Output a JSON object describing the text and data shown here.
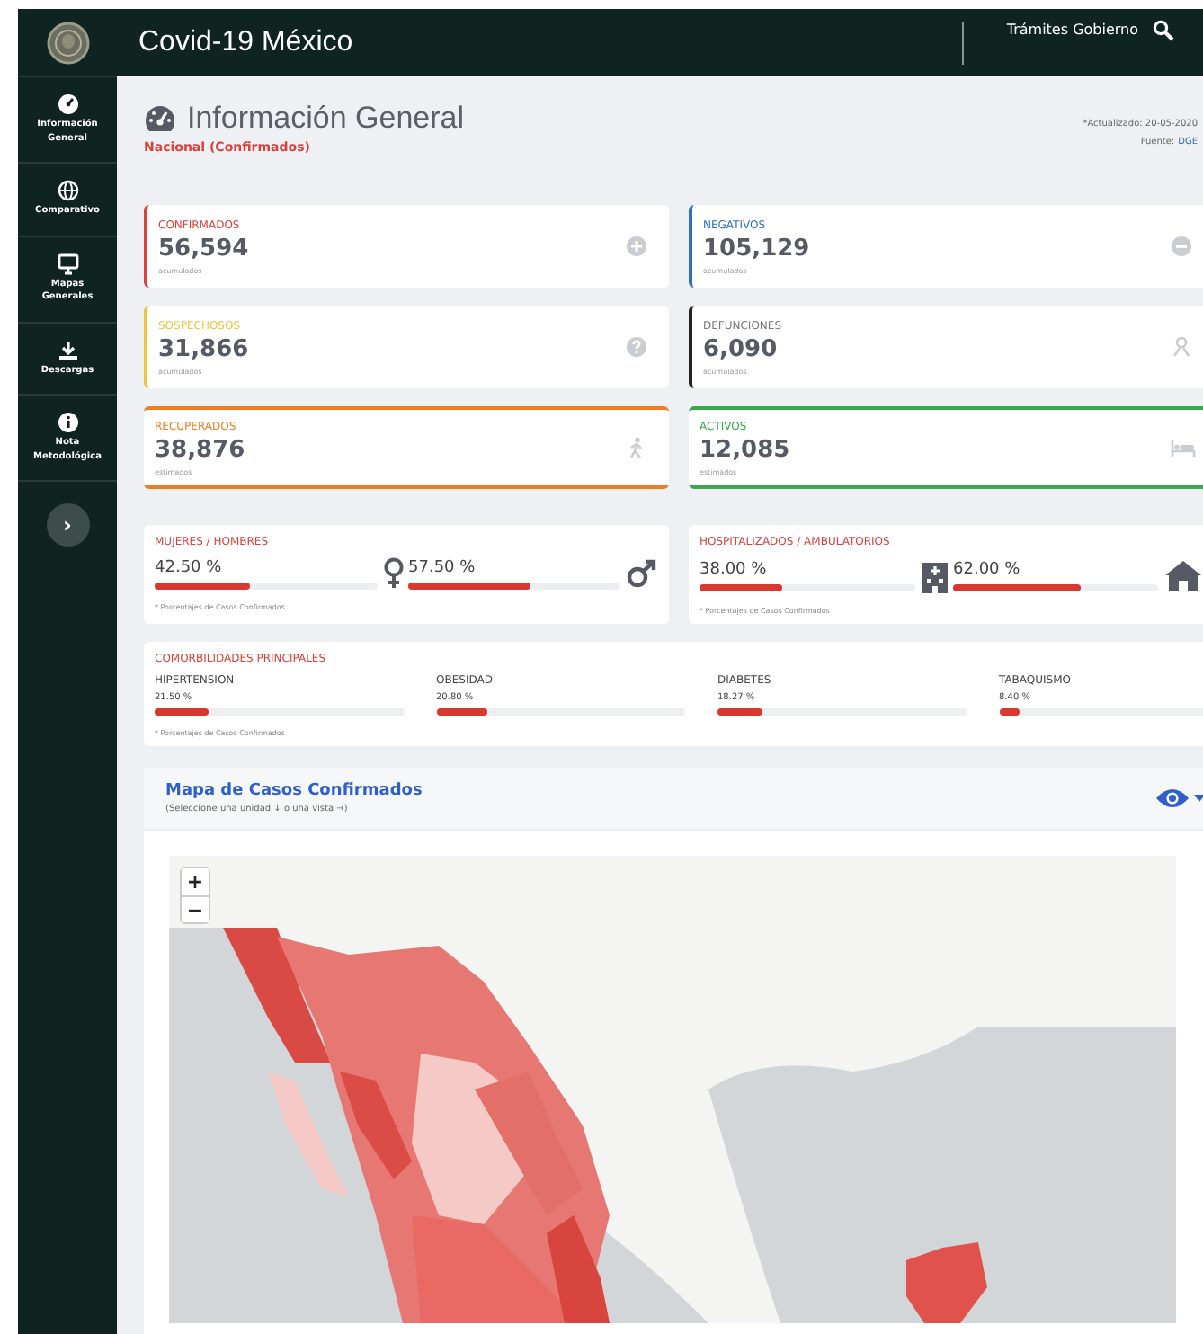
{
  "header": {
    "title": "Covid-19 México",
    "link": "Trámites Gobierno"
  },
  "sidebar": {
    "items": [
      {
        "label": "Información General"
      },
      {
        "label": "Comparativo"
      },
      {
        "label": "Mapas Generales"
      },
      {
        "label": "Descargas"
      },
      {
        "label": "Nota Metodológica"
      }
    ],
    "expand_button": "›"
  },
  "page": {
    "title": "Información General",
    "subtitle": "Nacional (Confirmados)",
    "updated": "*Actualizado: 20-05-2020",
    "source_label": "Fuente:",
    "source_link": "DGE"
  },
  "stat_cards": [
    {
      "label": "CONFIRMADOS",
      "value": "56,594",
      "note": "acumulados",
      "color": "#d9413a",
      "kind": "side"
    },
    {
      "label": "NEGATIVOS",
      "value": "105,129",
      "note": "acumulados",
      "color": "#2f6fc4",
      "kind": "side"
    },
    {
      "label": "SOSPECHOSOS",
      "value": "31,866",
      "note": "acumulados",
      "color": "#f0c43c",
      "kind": "side"
    },
    {
      "label": "DEFUNCIONES",
      "value": "6,090",
      "note": "acumulados",
      "color": "#222222",
      "kind": "side"
    },
    {
      "label": "RECUPERADOS",
      "value": "38,876",
      "note": "estimados",
      "color": "#ef7d22",
      "kind": "banded"
    },
    {
      "label": "ACTIVOS",
      "value": "12,085",
      "note": "estimados",
      "color": "#3aa84a",
      "kind": "banded"
    }
  ],
  "ratio_panels": [
    {
      "title": "MUJERES / HOMBRES",
      "footnote": "* Porcentajes de Casos Confirmados",
      "items": [
        {
          "reading": "42.50 %",
          "level": 0.425
        },
        {
          "reading": "57.50 %",
          "level": 0.575
        }
      ]
    },
    {
      "title": "HOSPITALIZADOS / AMBULATORIOS",
      "footnote": "* Porcentajes de Casos Confirmados",
      "items": [
        {
          "reading": "38.00 %",
          "level": 0.38
        },
        {
          "reading": "62.00 %",
          "level": 0.62
        }
      ]
    }
  ],
  "comorbidities": {
    "title": "COMORBILIDADES PRINCIPALES",
    "footnote": "* Porcentajes de Casos Confirmados",
    "items": [
      {
        "name": "HIPERTENSION",
        "reading": "21.50 %",
        "level": 0.215
      },
      {
        "name": "OBESIDAD",
        "reading": "20.80 %",
        "level": 0.208
      },
      {
        "name": "DIABETES",
        "reading": "18.27 %",
        "level": 0.1827
      },
      {
        "name": "TABAQUISMO",
        "reading": "8.40 %",
        "level": 0.084
      }
    ]
  },
  "map": {
    "title": "Mapa de Casos Confirmados",
    "hint": "(Seleccione una unidad ↓ o una vista →)",
    "zoom_in": "+",
    "zoom_out": "−"
  }
}
